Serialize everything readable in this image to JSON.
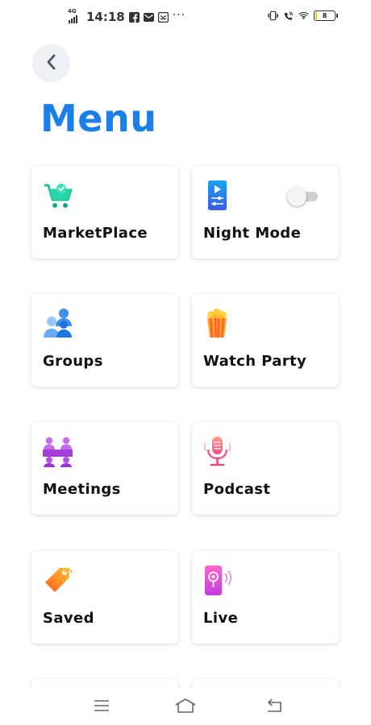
{
  "status_bar": {
    "network": "4G",
    "time": "14:18",
    "more": "···",
    "battery_level": "8",
    "battery_fraction": 0.08
  },
  "header": {
    "back_icon": "chevron-left-icon",
    "title": "Menu"
  },
  "menu": {
    "items": [
      {
        "label": "MarketPlace",
        "icon": "shopping-cart-icon"
      },
      {
        "label": "Night Mode",
        "icon": "phone-settings-icon",
        "toggle": false
      },
      {
        "label": "Groups",
        "icon": "groups-icon"
      },
      {
        "label": "Watch Party",
        "icon": "popcorn-icon"
      },
      {
        "label": "Meetings",
        "icon": "meetings-icon"
      },
      {
        "label": "Podcast",
        "icon": "microphone-icon"
      },
      {
        "label": "Saved",
        "icon": "tag-icon"
      },
      {
        "label": "Live",
        "icon": "live-phone-icon"
      }
    ]
  },
  "nav_bar": {
    "icons": [
      "menu-icon",
      "home-icon",
      "back-icon"
    ]
  },
  "colors": {
    "accent": "#1c7ee8",
    "card_background": "#ffffff",
    "back_button_background": "#edf0f4"
  }
}
